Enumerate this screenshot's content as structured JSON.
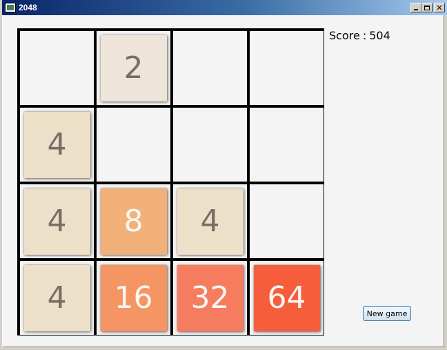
{
  "window": {
    "title": "2048",
    "controls": [
      "minimize",
      "maximize",
      "close"
    ],
    "close_glyph": "✕"
  },
  "score": {
    "label": "Score",
    "separator": ":",
    "value": "504"
  },
  "new_game_button": {
    "label": "New game"
  },
  "board": {
    "size": 4,
    "rows": [
      [
        "",
        "2",
        "",
        ""
      ],
      [
        "4",
        "",
        "",
        ""
      ],
      [
        "4",
        "8",
        "4",
        ""
      ],
      [
        "4",
        "16",
        "32",
        "64"
      ]
    ]
  },
  "tile_colors": {
    "2": {
      "bg": "#eee4da",
      "fg": "#776e65"
    },
    "4": {
      "bg": "#ede0c8",
      "fg": "#776e65"
    },
    "8": {
      "bg": "#f2b179",
      "fg": "#f9f6f2"
    },
    "16": {
      "bg": "#f59563",
      "fg": "#f9f6f2"
    },
    "32": {
      "bg": "#f67c5f",
      "fg": "#f9f6f2"
    },
    "64": {
      "bg": "#f65e3b",
      "fg": "#f9f6f2"
    }
  }
}
